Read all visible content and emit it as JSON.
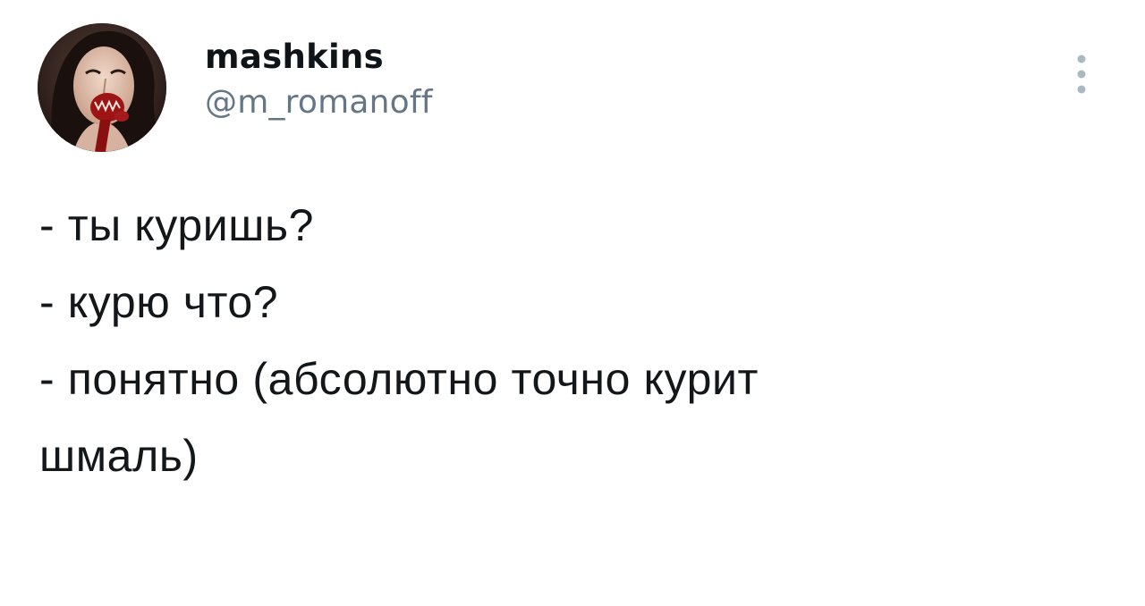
{
  "user": {
    "display_name": "mashkins",
    "handle": "@m_romanoff",
    "avatar_icon": "profile-photo"
  },
  "menu": {
    "icon": "more-vertical-icon"
  },
  "tweet": {
    "lines": [
      "- ты куришь?",
      "- курю что?",
      "- понятно (абсолютно точно курит",
      "шмаль)"
    ]
  },
  "colors": {
    "text": "#14171a",
    "secondary": "#657786",
    "icon": "#aab8c2",
    "background": "#ffffff"
  }
}
